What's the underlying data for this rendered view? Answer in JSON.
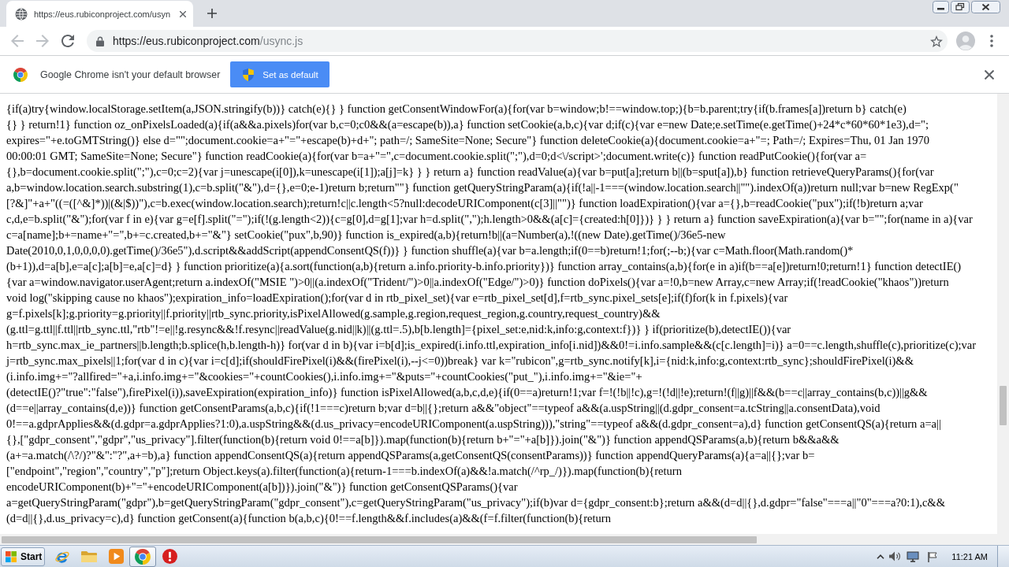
{
  "browser": {
    "tabs": [
      {
        "title": "https://eus.rubiconproject.com/usyn",
        "selected": true
      }
    ],
    "address_bar": {
      "url_host": "https://eus.rubiconproject.com",
      "url_path": "/usync.js"
    }
  },
  "infobar": {
    "message": "Google Chrome isn't your default browser",
    "button": "Set as default"
  },
  "page": {
    "lines": [
      "{if(a)try{window.localStorage.setItem(a,JSON.stringify(b))} catch(e){} } function getConsentWindowFor(a){for(var b=window;b!==window.top;){b=b.parent;try{if(b.frames[a])return b} catch(e)",
      "{} } return!1} function oz_onPixelsLoaded(a){if(a&&a.pixels)for(var b,c=0;c0&&(a=escape(b)),a} function setCookie(a,b,c){var d;if(c){var e=new Date;e.setTime(e.getTime()+24*c*60*60*1e3),d=\";",
      "expires=\"+e.toGMTString()} else d=\"\";document.cookie=a+\"=\"+escape(b)+d+\"; path=/; SameSite=None; Secure\"} function deleteCookie(a){document.cookie=a+\"=; Path=/; Expires=Thu, 01 Jan 1970",
      "00:00:01 GMT; SameSite=None; Secure\"} function readCookie(a){for(var b=a+\"=\",c=document.cookie.split(\";\"),d=0;d<\\/script>';document.write(c)} function readPutCookie(){for(var a=",
      "{},b=document.cookie.split(\";\"),c=0;c=2){var j=unescape(i[0]),k=unescape(i[1]);a[j]=k} } } return a} function readValue(a){var b=put[a];return b||(b=sput[a]),b} function retrieveQueryParams(){for(var",
      "a,b=window.location.search.substring(1),c=b.split(\"&\"),d={},e=0;e-1)return b;return\"\"} function getQueryStringParam(a){if(!a||-1===(window.location.search||\"\").indexOf(a))return null;var b=new RegExp(\"",
      "[?&]\"+a+\"((=([^&]*))|(&|$))\"),c=b.exec(window.location.search);return!c||c.length<5?null:decodeURIComponent(c[3]||\"\")} function loadExpiration(){var a={},b=readCookie(\"pux\");if(!b)return a;var",
      "c,d,e=b.split(\"&\");for(var f in e){var g=e[f].split(\"=\");if(!(g.length<2)){c=g[0],d=g[1];var h=d.split(\",\");h.length>0&&(a[c]={created:h[0]})} } } return a} function saveExpiration(a){var b=\"\";for(name in a){var",
      "c=a[name];b+=name+\"=\",b+=c.created,b+=\"&\"} setCookie(\"pux\",b,90)} function is_expired(a,b){return!b||(a=Number(a),!((new Date).getTime()/36e5-new",
      "Date(2010,0,1,0,0,0,0).getTime()/36e5\"),d.script&&addScript(appendConsentQS(f))} } function shuffle(a){var b=a.length;if(0==b)return!1;for(;--b;){var c=Math.floor(Math.random()*",
      "(b+1)),d=a[b],e=a[c];a[b]=e,a[c]=d} } function prioritize(a){a.sort(function(a,b){return a.info.priority-b.info.priority})} function array_contains(a,b){for(e in a)if(b==a[e])return!0;return!1} function detectIE()",
      "{var a=window.navigator.userAgent;return a.indexOf(\"MSIE \")>0||(a.indexOf(\"Trident/\")>0||a.indexOf(\"Edge/\")>0)} function doPixels(){var a=!0,b=new Array,c=new Array;if(!readCookie(\"khaos\"))return",
      "void log(\"skipping cause no khaos\");expiration_info=loadExpiration();for(var d in rtb_pixel_set){var e=rtb_pixel_set[d],f=rtb_sync.pixel_sets[e];if(f)for(k in f.pixels){var",
      "g=f.pixels[k];g.priority=g.priority||f.priority||rtb_sync.priority,isPixelAllowed(g.sample,g.region,request_region,g.country,request_country)&&",
      "(g.ttl=g.ttl||f.ttl||rtb_sync.ttl,\"rtb\"!=e||!g.resync&&!f.resync||readValue(g.nid||k)||(g.ttl=.5),b[b.length]={pixel_set:e,nid:k,info:g,context:f})} } if(prioritize(b),detectIE()){var",
      "h=rtb_sync.max_ie_partners||b.length;b.splice(h,b.length-h)} for(var d in b){var i=b[d];is_expired(i.info.ttl,expiration_info[i.nid])&&0!=i.info.sample&&(c[c.length]=i)} a=0==c.length,shuffle(c),prioritize(c);var",
      "j=rtb_sync.max_pixels||1;for(var d in c){var i=c[d];if(shouldFirePixel(i)&&(firePixel(i),--j<=0))break} var k=\"rubicon\",g=rtb_sync.notify[k],i={nid:k,info:g,context:rtb_sync};shouldFirePixel(i)&&",
      "(i.info.img+=\"?allfired=\"+a,i.info.img+=\"&cookies=\"+countCookies(),i.info.img+=\"&puts=\"+countCookies(\"put_\"),i.info.img+=\"&ie=\"+",
      "(detectIE()?\"true\":\"false\"),firePixel(i)),saveExpiration(expiration_info)} function isPixelAllowed(a,b,c,d,e){if(0==a)return!1;var f=!(!b||!c),g=!(!d||!e);return!(f||g)||f&&(b==c||array_contains(b,c))||g&&",
      "(d==e||array_contains(d,e))} function getConsentParams(a,b,c){if(!1===c)return b;var d=b||{};return a&&\"object\"==typeof a&&(a.uspString||(d.gdpr_consent=a.tcString||a.consentData),void",
      "0!==a.gdprApplies&&(d.gdpr=a.gdprApplies?1:0),a.uspString&&(d.us_privacy=encodeURIComponent(a.uspString))),\"string\"==typeof a&&(d.gdpr_consent=a),d} function getConsentQS(a){return a=a||",
      "{},[\"gdpr_consent\",\"gdpr\",\"us_privacy\"].filter(function(b){return void 0!==a[b]}).map(function(b){return b+\"=\"+a[b]}).join(\"&\")} function appendQSParams(a,b){return b&&a&&",
      "(a+=a.match(/\\?/)?\"&\":\"?\",a+=b),a} function appendConsentQS(a){return appendQSParams(a,getConsentQS(consentParams))} function appendQueryParams(a){a=a||{};var b=",
      "[\"endpoint\",\"region\",\"country\",\"p\"];return Object.keys(a).filter(function(a){return-1===b.indexOf(a)&&!a.match(/^rp_/)}).map(function(b){return",
      "encodeURIComponent(b)+\"=\"+encodeURIComponent(a[b])}).join(\"&\")} function getConsentQSParams(){var",
      "a=getQueryStringParam(\"gdpr\"),b=getQueryStringParam(\"gdpr_consent\"),c=getQueryStringParam(\"us_privacy\");if(b)var d={gdpr_consent:b};return a&&(d=d||{},d.gdpr=\"false\"===a||\"0\"===a?0:1),c&&",
      "(d=d||{},d.us_privacy=c),d} function getConsent(a){function b(a,b,c){0!==f.length&&f.includes(a)&&(f=f.filter(function(b){return"
    ]
  },
  "taskbar": {
    "start": "Start",
    "apps": [
      {
        "kind": "ie",
        "selected": false
      },
      {
        "kind": "folder",
        "selected": false
      },
      {
        "kind": "media",
        "selected": false
      },
      {
        "kind": "chrome",
        "selected": true
      },
      {
        "kind": "alert",
        "selected": false
      }
    ],
    "clock": "11:21 AM"
  }
}
